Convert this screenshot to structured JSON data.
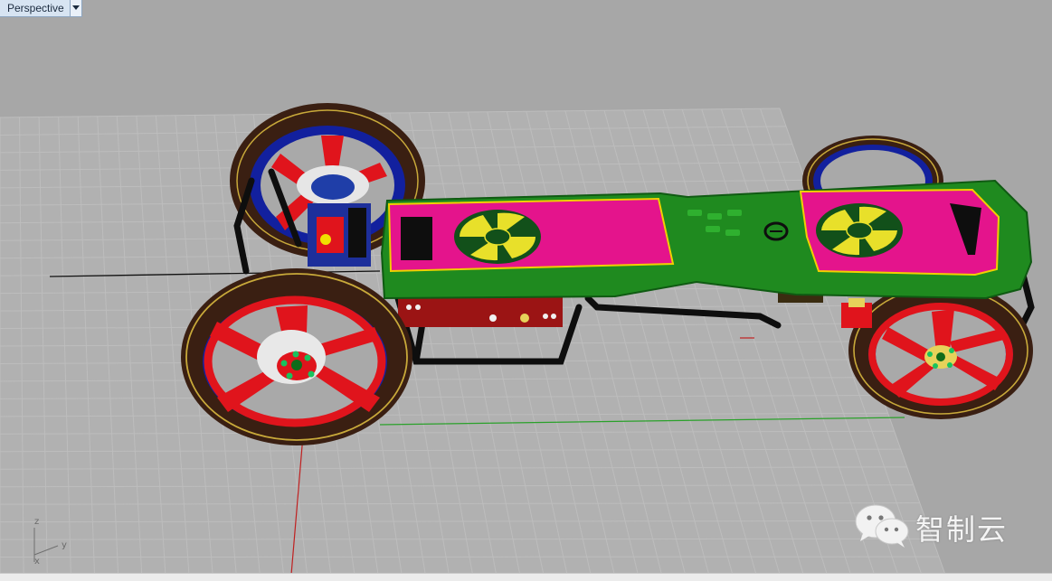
{
  "viewport": {
    "label": "Perspective",
    "dropdown_icon": "chevron-down-icon"
  },
  "axis_widget": {
    "z": "z",
    "y": "y",
    "x": "x"
  },
  "watermark": {
    "text": "智制云",
    "icon": "wechat-icon"
  },
  "colors": {
    "viewport_bg": "#a7a7a7",
    "grid": "#bdbdbd",
    "chassis_green": "#1f8a1f",
    "deck_magenta": "#e4148c",
    "wheel_red": "#e0141c",
    "tire_brown": "#3a1f12",
    "frame_black": "#0e0e0e"
  }
}
